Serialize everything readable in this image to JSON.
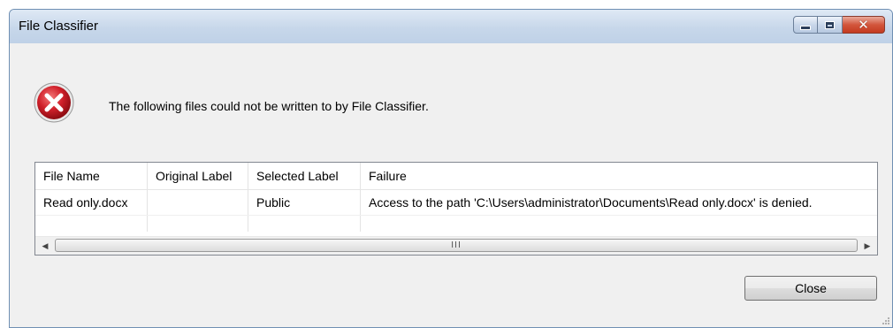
{
  "window": {
    "title": "File Classifier",
    "controls": {
      "minimize": "minimize",
      "maximize": "maximize",
      "close": "close"
    }
  },
  "message": "The following files could not be written to by File Classifier.",
  "table": {
    "columns": [
      "File Name",
      "Original Label",
      "Selected Label",
      "Failure"
    ],
    "rows": [
      [
        "Read only.docx",
        "",
        "Public",
        "Access to the path 'C:\\Users\\administrator\\Documents\\Read only.docx' is denied."
      ]
    ]
  },
  "scrollbar": {
    "grip": "III"
  },
  "buttons": {
    "close": "Close"
  },
  "icons": {
    "error": "error-icon",
    "scroll_left": "scroll-left-arrow-icon",
    "scroll_right": "scroll-right-arrow-icon"
  },
  "colors": {
    "error_red": "#d0202a",
    "titlebar": "#c7d7ea",
    "close_button": "#d2553c"
  }
}
